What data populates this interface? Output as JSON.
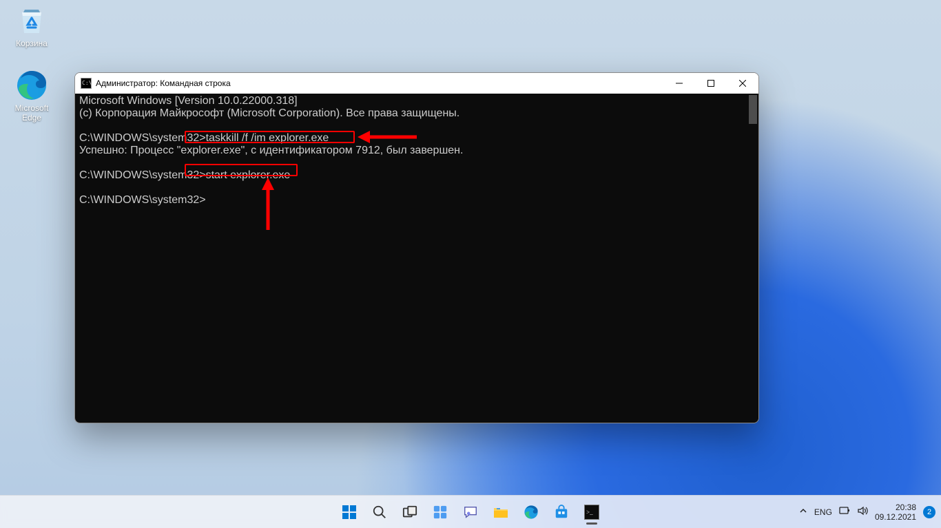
{
  "desktop_icons": {
    "recycle_bin": "Корзина",
    "edge": "Microsoft Edge"
  },
  "window": {
    "title": "Администратор: Командная строка"
  },
  "terminal": {
    "line1": "Microsoft Windows [Version 10.0.22000.318]",
    "line2": "(c) Корпорация Майкрософт (Microsoft Corporation). Все права защищены.",
    "blank1": "",
    "prompt1_prefix": "C:\\WINDOWS\\system32>",
    "command1": "taskkill /f /im explorer.exe",
    "result1": "Успешно: Процесс \"explorer.exe\", с идентификатором 7912, был завершен.",
    "blank2": "",
    "prompt2_prefix": "C:\\WINDOWS\\system32>",
    "command2": "start explorer.exe",
    "blank3": "",
    "prompt3": "C:\\WINDOWS\\system32>"
  },
  "taskbar": {
    "lang": "ENG",
    "time": "20:38",
    "date": "09.12.2021",
    "badge": "2"
  }
}
